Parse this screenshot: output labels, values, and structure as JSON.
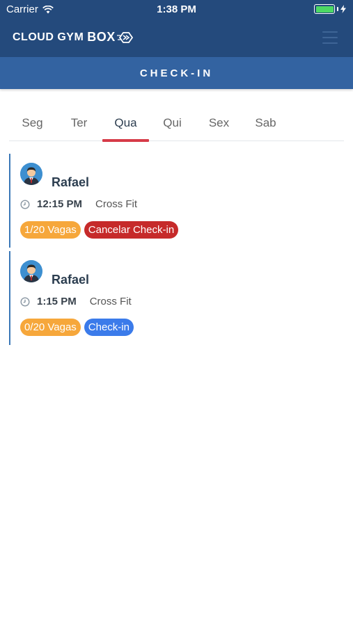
{
  "status_bar": {
    "carrier": "Carrier",
    "time": "1:38 PM"
  },
  "app": {
    "logo_part1": "CLOUD GYM",
    "logo_part2": "BOX",
    "icons": {
      "menu": "hamburger-menu-icon"
    }
  },
  "page": {
    "title": "CHECK-IN"
  },
  "tabs": {
    "items": [
      {
        "label": "Seg"
      },
      {
        "label": "Ter"
      },
      {
        "label": "Qua"
      },
      {
        "label": "Qui"
      },
      {
        "label": "Sex"
      },
      {
        "label": "Sab"
      }
    ],
    "active": "Qua"
  },
  "classes": [
    {
      "instructor": "Rafael",
      "time": "12:15 PM",
      "class": "Cross Fit",
      "vagas": "1/20 Vagas",
      "action": "Cancelar Check-in",
      "action_type": "cancel"
    },
    {
      "instructor": "Rafael",
      "time": "1:15 PM",
      "class": "Cross Fit",
      "vagas": "0/20 Vagas",
      "action": "Check-in",
      "action_type": "checkin"
    }
  ],
  "colors": {
    "header": "#244a7c",
    "titlebar": "#3363a1",
    "active_tab": "#d63b48",
    "vagas_badge": "#f6a73b",
    "cancel_badge": "#c62a2a",
    "checkin_badge": "#3b7bea"
  }
}
